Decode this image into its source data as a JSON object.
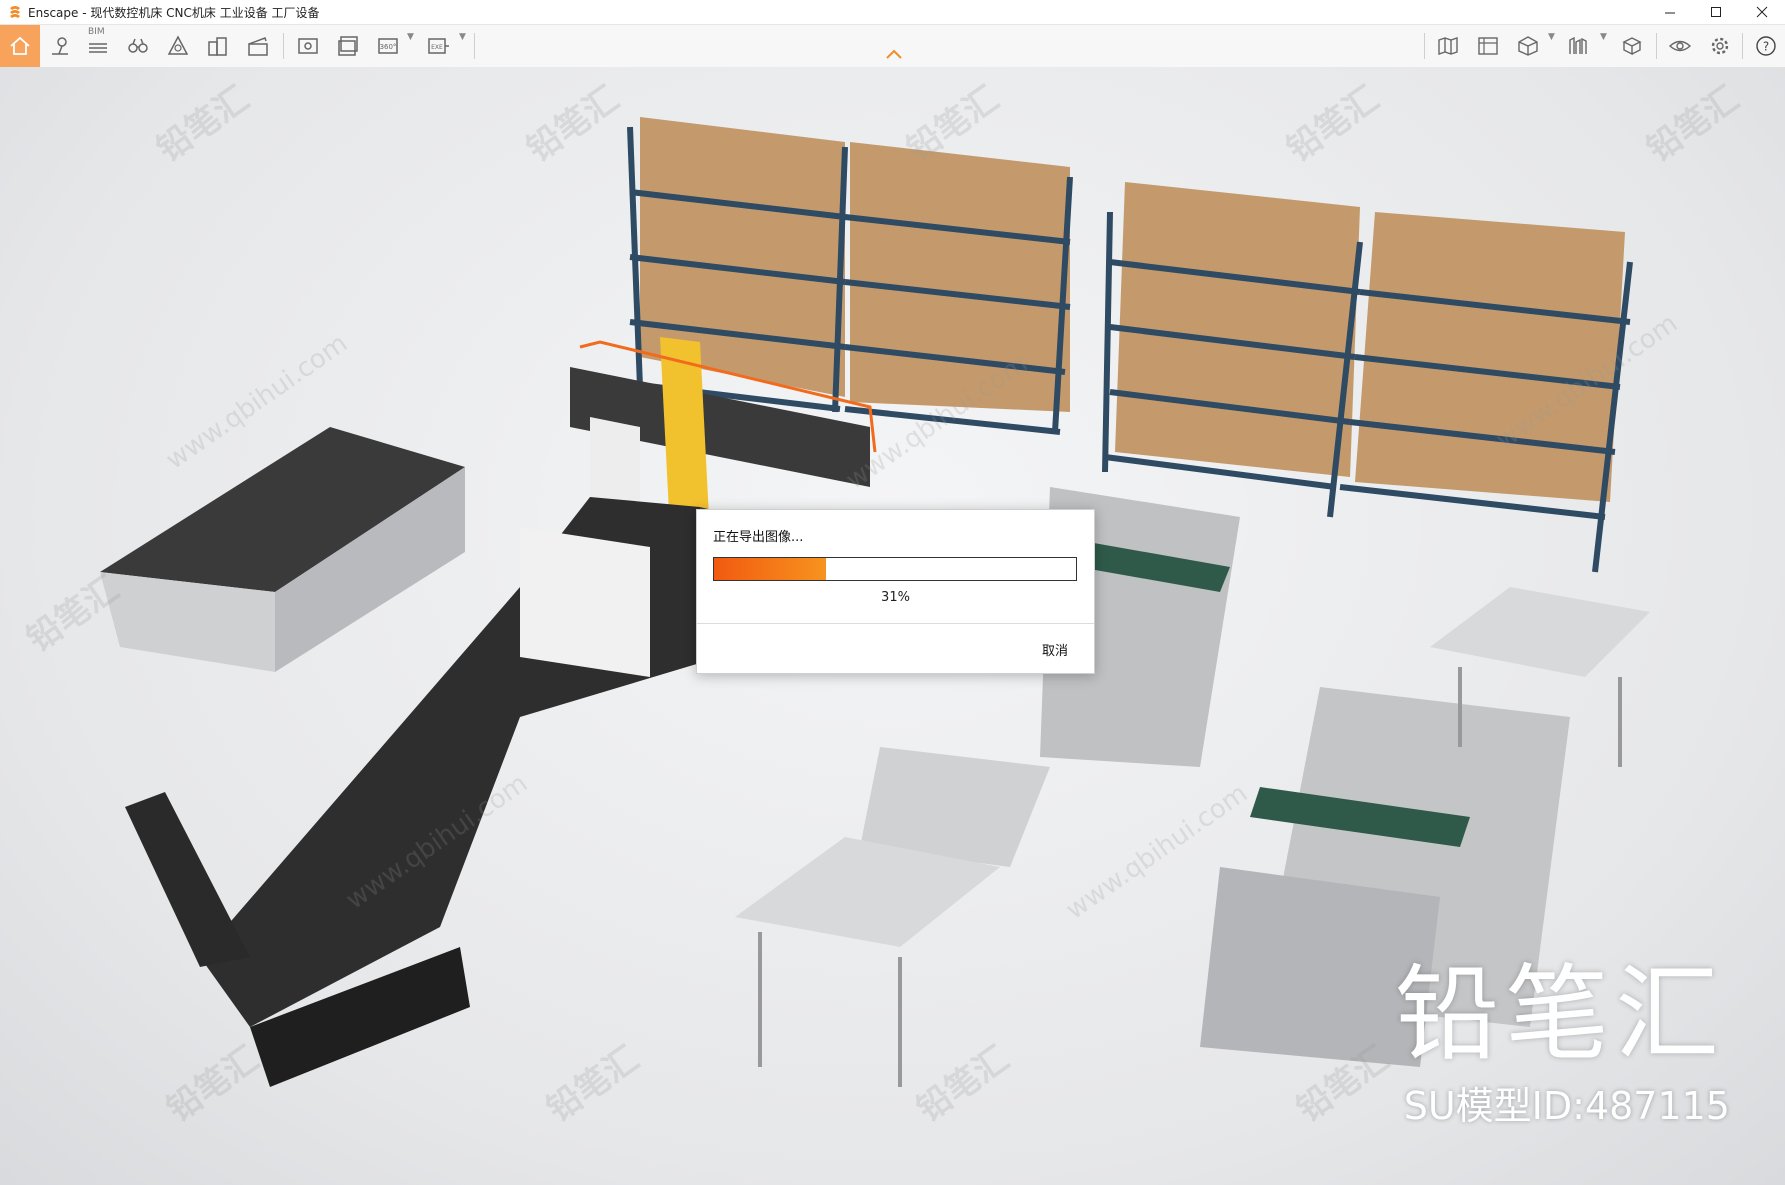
{
  "window": {
    "title": "Enscape - 现代数控机床 CNC机床 工业设备 工厂设备",
    "minimize_icon": "minimize-icon",
    "maximize_icon": "maximize-icon",
    "close_icon": "close-icon"
  },
  "toolbar": {
    "bim_label": "BIM",
    "left_icons": [
      "home-icon",
      "location-pin-icon",
      "bim-list-icon",
      "binoculars-icon",
      "material-icon",
      "buildings-icon",
      "clapper-icon",
      "screenshot-icon",
      "batch-render-icon",
      "panorama-360-icon",
      "export-exe-icon"
    ],
    "right_icons": [
      "map-icon",
      "atlas-icon",
      "asset-box-icon",
      "views-icon",
      "asset-library-icon",
      "visual-settings-icon",
      "settings-icon",
      "help-icon"
    ],
    "accent_color": "#f7a35c"
  },
  "dialog": {
    "title": "正在导出图像...",
    "progress": 0.31,
    "progress_label": "31%",
    "cancel_label": "取消"
  },
  "watermark": {
    "brand": "铅笔汇",
    "url": "www.qbihui.com",
    "model_id": "SU模型ID:487115"
  }
}
